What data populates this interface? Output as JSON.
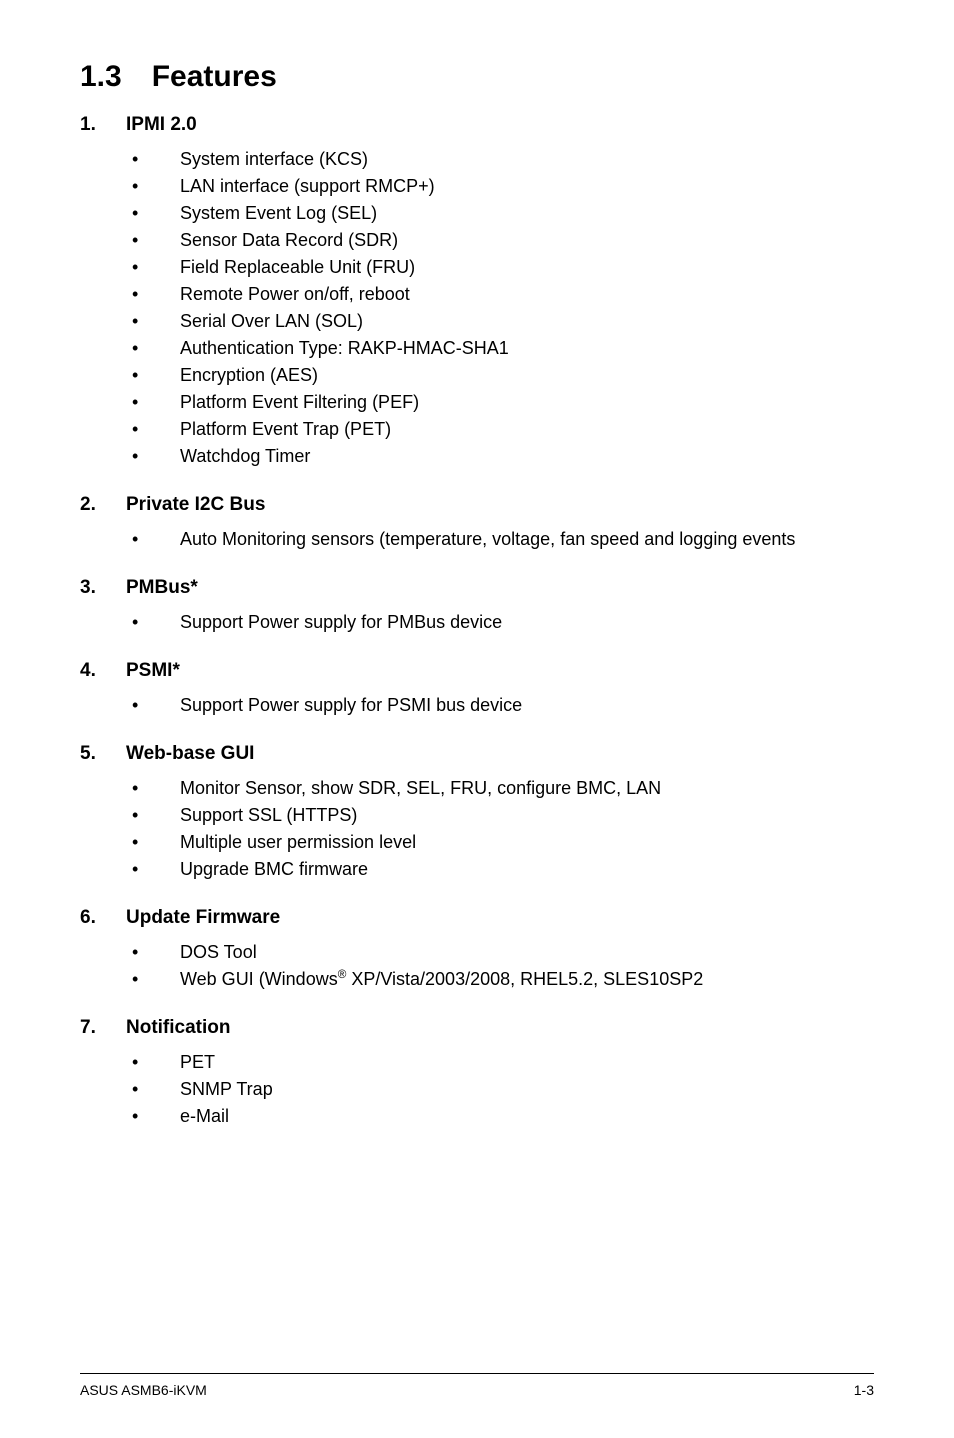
{
  "header": {
    "section_number": "1.3",
    "section_title": "Features"
  },
  "features": [
    {
      "num": "1.",
      "title": "IPMI 2.0",
      "items": [
        "System interface (KCS)",
        "LAN interface (support RMCP+)",
        "System Event Log (SEL)",
        "Sensor Data Record (SDR)",
        "Field Replaceable Unit (FRU)",
        "Remote Power on/off, reboot",
        "Serial Over LAN (SOL)",
        "Authentication Type: RAKP-HMAC-SHA1",
        "Encryption (AES)",
        "Platform Event Filtering (PEF)",
        "Platform Event Trap (PET)",
        "Watchdog Timer"
      ]
    },
    {
      "num": "2.",
      "title": "Private I2C Bus",
      "items": [
        "Auto Monitoring sensors (temperature, voltage, fan speed and logging events"
      ]
    },
    {
      "num": "3.",
      "title": "PMBus*",
      "items": [
        "Support Power supply for PMBus device"
      ]
    },
    {
      "num": "4.",
      "title": "PSMI*",
      "items": [
        "Support Power supply for PSMI bus device"
      ]
    },
    {
      "num": "5.",
      "title": "Web-base GUI",
      "items": [
        "Monitor Sensor, show SDR, SEL, FRU, configure BMC, LAN",
        "Support SSL (HTTPS)",
        "Multiple user permission level",
        "Upgrade BMC firmware"
      ]
    },
    {
      "num": "6.",
      "title": "Update Firmware",
      "items": [
        "DOS Tool",
        "Web GUI (Windows® XP/Vista/2003/2008, RHEL5.2, SLES10SP2"
      ]
    },
    {
      "num": "7.",
      "title": "Notification",
      "items": [
        "PET",
        "SNMP Trap",
        "e-Mail"
      ]
    }
  ],
  "footer": {
    "left": "ASUS ASMB6-iKVM",
    "right": "1-3"
  }
}
